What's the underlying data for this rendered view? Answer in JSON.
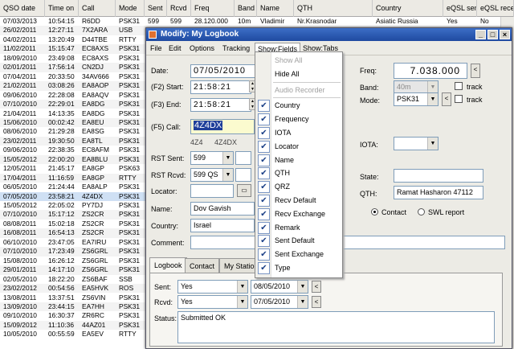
{
  "background_table": {
    "columns": [
      "QSO date",
      "Time on",
      "Call",
      "Mode",
      "Sent",
      "Rcvd",
      "Freq",
      "Band",
      "Name",
      "QTH",
      "Country",
      "eQSL sent",
      "eQSL rece"
    ],
    "first_row": {
      "date": "07/03/2013",
      "time": "10:54:15",
      "call": "R6DD",
      "mode": "PSK31",
      "sent": "599",
      "rcvd": "599",
      "freq": "28.120.000",
      "band": "10m",
      "name": "Vladimir",
      "qth": "Nr.Krasnodar",
      "country": "Asiatic Russia",
      "eqsl_sent": "Yes",
      "eqsl_rcvd": "No"
    },
    "rows": [
      [
        "07/03/2013",
        "10:54:15",
        "R6DD",
        "PSK31"
      ],
      [
        "26/02/2011",
        "12:27:11",
        "7X2ARA",
        "USB"
      ],
      [
        "04/02/2011",
        "13:20:49",
        "D44TBE",
        "RTTY"
      ],
      [
        "11/02/2011",
        "15:15:47",
        "EC8AXS",
        "PSK31"
      ],
      [
        "18/09/2010",
        "23:49:08",
        "EC8AXS",
        "PSK31"
      ],
      [
        "02/01/2011",
        "17:56:14",
        "CN2DJ",
        "PSK31"
      ],
      [
        "07/04/2011",
        "20:33:50",
        "34AV666",
        "PSK31"
      ],
      [
        "21/02/2011",
        "03:08:26",
        "EA8AOP",
        "PSK31"
      ],
      [
        "09/06/2010",
        "22:28:08",
        "EA8AQV",
        "PSK31"
      ],
      [
        "07/10/2010",
        "22:29:01",
        "EA8DG",
        "PSK31"
      ],
      [
        "21/04/2011",
        "14:13:35",
        "EA8DG",
        "PSK31"
      ],
      [
        "15/06/2010",
        "00:02:42",
        "EA8EU",
        "PSK31"
      ],
      [
        "08/06/2010",
        "21:29:28",
        "EA8SG",
        "PSK31"
      ],
      [
        "23/02/2011",
        "19:30:50",
        "EA8TL",
        "PSK31"
      ],
      [
        "09/06/2010",
        "22:38:35",
        "EC8AFM",
        "PSK31"
      ],
      [
        "15/05/2012",
        "22:00:20",
        "EA8BLU",
        "PSK31"
      ],
      [
        "12/05/2011",
        "21:45:17",
        "EA8GP",
        "PSK63"
      ],
      [
        "17/04/2011",
        "11:16:59",
        "EA8GP",
        "RTTY"
      ],
      [
        "06/05/2010",
        "21:24:44",
        "EA8ALP",
        "PSK31"
      ],
      [
        "07/05/2010",
        "23:58:21",
        "4Z4DX",
        "PSK31"
      ],
      [
        "15/05/2012",
        "22:05:02",
        "PY7DJ",
        "PSK31"
      ],
      [
        "07/10/2010",
        "15:17:12",
        "ZS2CR",
        "PSK31"
      ],
      [
        "08/08/2011",
        "15:02:18",
        "ZS2CR",
        "PSK31"
      ],
      [
        "16/08/2011",
        "16:54:13",
        "ZS2CR",
        "PSK31"
      ],
      [
        "06/10/2010",
        "23:47:05",
        "EA7IRU",
        "PSK31"
      ],
      [
        "07/10/2010",
        "17:23:49",
        "ZS6GRL",
        "PSK31"
      ],
      [
        "15/08/2010",
        "16:26:12",
        "ZS6GRL",
        "PSK31"
      ],
      [
        "29/01/2011",
        "14:17:10",
        "ZS6GRL",
        "PSK31"
      ],
      [
        "02/05/2010",
        "18:22:20",
        "ZS6BAF",
        "SSB"
      ],
      [
        "23/02/2012",
        "00:54:56",
        "EA5HVK",
        "ROS"
      ],
      [
        "13/08/2011",
        "13:37:51",
        "ZS6VIN",
        "PSK31"
      ],
      [
        "13/09/2010",
        "23:44:15",
        "EA7HH",
        "PSK31"
      ],
      [
        "09/10/2010",
        "16:30:37",
        "ZR6RC",
        "PSK31"
      ],
      [
        "15/09/2012",
        "11:10:36",
        "44AZ01",
        "PSK31"
      ],
      [
        "10/05/2010",
        "00:55:59",
        "EA5EV",
        "RTTY"
      ]
    ]
  },
  "dialog": {
    "title": "Modify: My Logbook",
    "menu": [
      "File",
      "Edit",
      "Options",
      "Tracking",
      "Show:Fields",
      "Show:Tabs"
    ],
    "date_label": "Date:",
    "date_value": "07/05/2010",
    "start_label": "(F2) Start:",
    "start_value": "21:58:21",
    "end_label": "(F3) End:",
    "end_value": "21:58:21",
    "call_label": "(F5) Call:",
    "call_value": "4Z4DX",
    "call_hint1": "4Z4",
    "call_hint2": "4Z4DX",
    "rst_sent_label": "RST Sent:",
    "rst_sent_value": "599",
    "rst_rcvd_label": "RST Rcvd:",
    "rst_rcvd_value": "599 QS",
    "locator_label": "Locator:",
    "name_label": "Name:",
    "name_value": "Dov Gavish",
    "country_label": "Country:",
    "country_value": "Israel",
    "comment_label": "Comment:",
    "freq_label": "Freq:",
    "freq_value": "7.038.000",
    "band_label": "Band:",
    "band_value": "40m",
    "mode_label": "Mode:",
    "mode_value": "PSK31",
    "track_label": "track",
    "iota_label": "IOTA:",
    "state_label": "State:",
    "qth_label": "QTH:",
    "qth_value": "Ramat Hasharon 47112",
    "contact_label": "Contact",
    "swl_label": "SWL report",
    "tabs": [
      "Logbook",
      "Contact",
      "My Station"
    ],
    "sent_label": "Sent:",
    "sent_value": "Yes",
    "sent_date": "08/05/2010",
    "rcvd_label": "Rcvd:",
    "rcvd_value": "Yes",
    "rcvd_date": "07/05/2010",
    "status_label": "Status:",
    "status_value": "Submitted OK",
    "prev_symbol": "<"
  },
  "dropdown": {
    "items": [
      {
        "label": "Show All",
        "disabled": true,
        "checked": false
      },
      {
        "label": "Hide All",
        "disabled": false,
        "checked": false
      },
      {
        "label": "Audio Recorder",
        "disabled": true,
        "checked": false
      },
      {
        "label": "Country",
        "disabled": false,
        "checked": true
      },
      {
        "label": "Frequency",
        "disabled": false,
        "checked": true
      },
      {
        "label": "IOTA",
        "disabled": false,
        "checked": true
      },
      {
        "label": "Locator",
        "disabled": false,
        "checked": true
      },
      {
        "label": "Name",
        "disabled": false,
        "checked": true
      },
      {
        "label": "QTH",
        "disabled": false,
        "checked": true
      },
      {
        "label": "QRZ",
        "disabled": false,
        "checked": true
      },
      {
        "label": "Recv Default",
        "disabled": false,
        "checked": true
      },
      {
        "label": "Recv Exchange",
        "disabled": false,
        "checked": true
      },
      {
        "label": "Remark",
        "disabled": false,
        "checked": true
      },
      {
        "label": "Sent Default",
        "disabled": false,
        "checked": true
      },
      {
        "label": "Sent Exchange",
        "disabled": false,
        "checked": true
      },
      {
        "label": "Type",
        "disabled": false,
        "checked": true
      }
    ]
  },
  "colors": {
    "titlebar": "#2a56b0",
    "call_highlight": "#1f3f9a",
    "grid_selected": "#cfe0f4"
  }
}
